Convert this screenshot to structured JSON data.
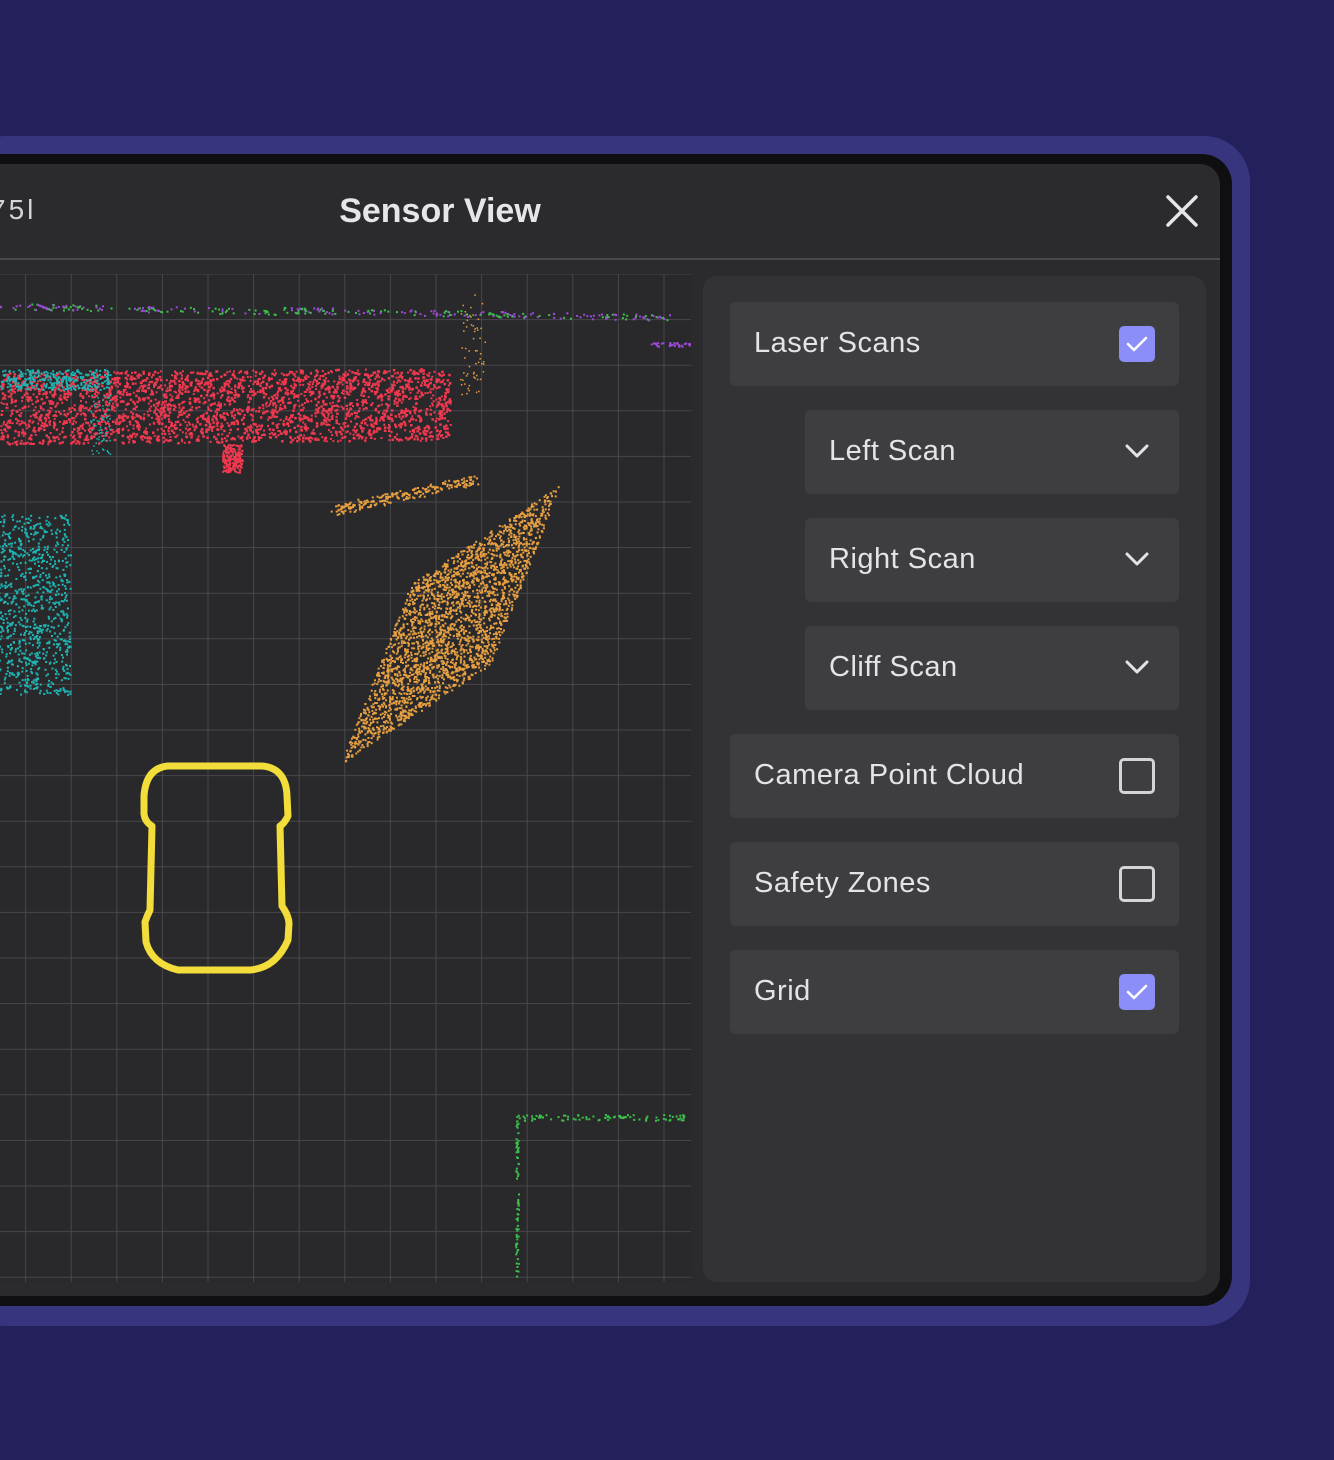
{
  "window": {
    "left_fragment": "75l",
    "title": "Sensor View",
    "close_icon": "close-icon"
  },
  "layers": {
    "laser_scans": {
      "label": "Laser Scans",
      "checked": true
    },
    "left_scan": {
      "label": "Left Scan",
      "icon": "chevron-down-icon"
    },
    "right_scan": {
      "label": "Right Scan",
      "icon": "chevron-down-icon"
    },
    "cliff_scan": {
      "label": "Cliff Scan",
      "icon": "chevron-down-icon"
    },
    "camera_point_cloud": {
      "label": "Camera Point Cloud",
      "checked": false
    },
    "safety_zones": {
      "label": "Safety Zones",
      "checked": false
    },
    "grid": {
      "label": "Grid",
      "checked": true
    }
  },
  "colors": {
    "background": "#23205c",
    "accent_checkbox": "#8a8ef6",
    "scan_red": "#f0384f",
    "scan_orange": "#e8a040",
    "scan_teal": "#1fb5b5",
    "scan_green": "#3cc04a",
    "scan_purple": "#9a4ad8",
    "robot_outline": "#f2dd3a"
  }
}
